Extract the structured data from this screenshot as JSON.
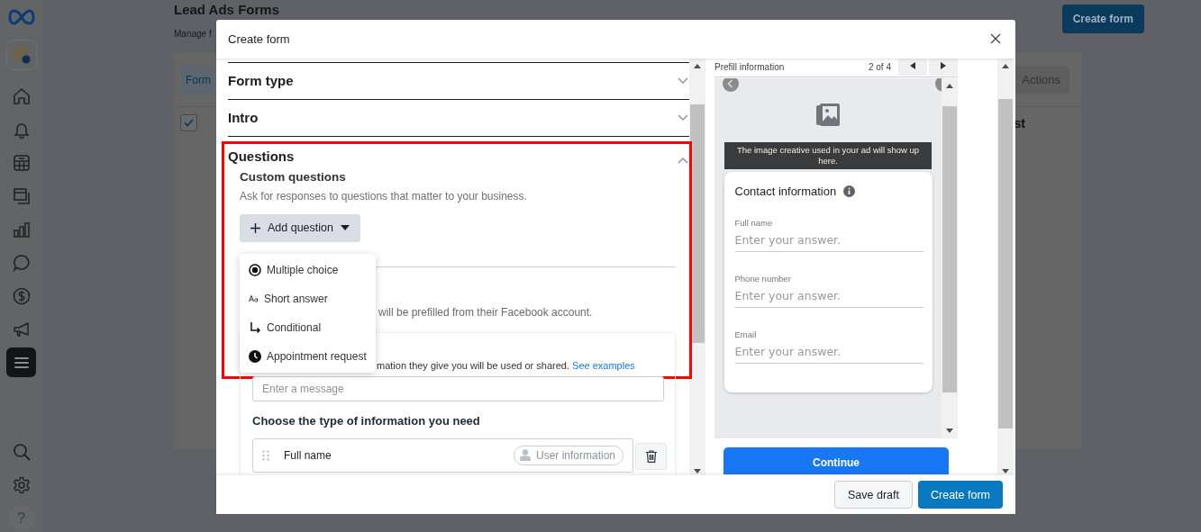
{
  "sidebar": {
    "nav_items": [
      {
        "kind": "home",
        "selected": false
      },
      {
        "kind": "bell",
        "selected": false
      },
      {
        "kind": "table",
        "selected": false
      },
      {
        "kind": "windows",
        "selected": false
      },
      {
        "kind": "chart",
        "selected": false
      },
      {
        "kind": "chat",
        "selected": false
      },
      {
        "kind": "dollar",
        "selected": false
      },
      {
        "kind": "megaphone",
        "selected": false
      },
      {
        "kind": "menu",
        "selected": true
      }
    ],
    "bottom_items": [
      {
        "kind": "search",
        "selected": false
      },
      {
        "kind": "settings",
        "selected": false
      },
      {
        "kind": "help",
        "label": "?",
        "selected": false
      }
    ]
  },
  "page": {
    "title": "Lead Ads Forms",
    "subtitle": "Manage f",
    "create_button": "Create form",
    "tab": "Form",
    "actions_button": "Actions",
    "select_all": {
      "checked": true
    },
    "column_header": "st"
  },
  "modal": {
    "title": "Create form",
    "sections": [
      {
        "title": "Form type",
        "expanded": false
      },
      {
        "title": "Intro",
        "expanded": false
      },
      {
        "title": "Questions",
        "expanded": true,
        "subheading": "Custom questions",
        "description": "Ask for responses to questions that matter to your business.",
        "add_button": "Add question",
        "menu": [
          {
            "kind": "radio",
            "label": "Multiple choice"
          },
          {
            "kind": "text",
            "label": "Short answer"
          },
          {
            "kind": "branch",
            "label": "Conditional"
          },
          {
            "kind": "clock",
            "label": "Appointment request"
          }
        ],
        "prefill_note": "will be prefilled from their Facebook account.",
        "privacy_note": "mation they give you will be used or shared.",
        "privacy_link": "See examples",
        "message_placeholder": "Enter a message",
        "info_heading": "Choose the type of information you need",
        "info_rows": [
          {
            "label": "Full name",
            "tag": "User information"
          }
        ]
      }
    ],
    "preview": {
      "heading": "Prefill information",
      "pager": "2 of 4",
      "banner": "The image creative used in your ad will show up here.",
      "card_title": "Contact information",
      "fields": [
        {
          "label": "Full name",
          "placeholder": "Enter your answer."
        },
        {
          "label": "Phone number",
          "placeholder": "Enter your answer."
        },
        {
          "label": "Email",
          "placeholder": "Enter your answer."
        }
      ],
      "continue_button": "Continue"
    },
    "footer": {
      "buttons": [
        {
          "label": "Save draft",
          "kind": "secondary"
        },
        {
          "label": "Create form",
          "kind": "primary"
        }
      ]
    }
  }
}
